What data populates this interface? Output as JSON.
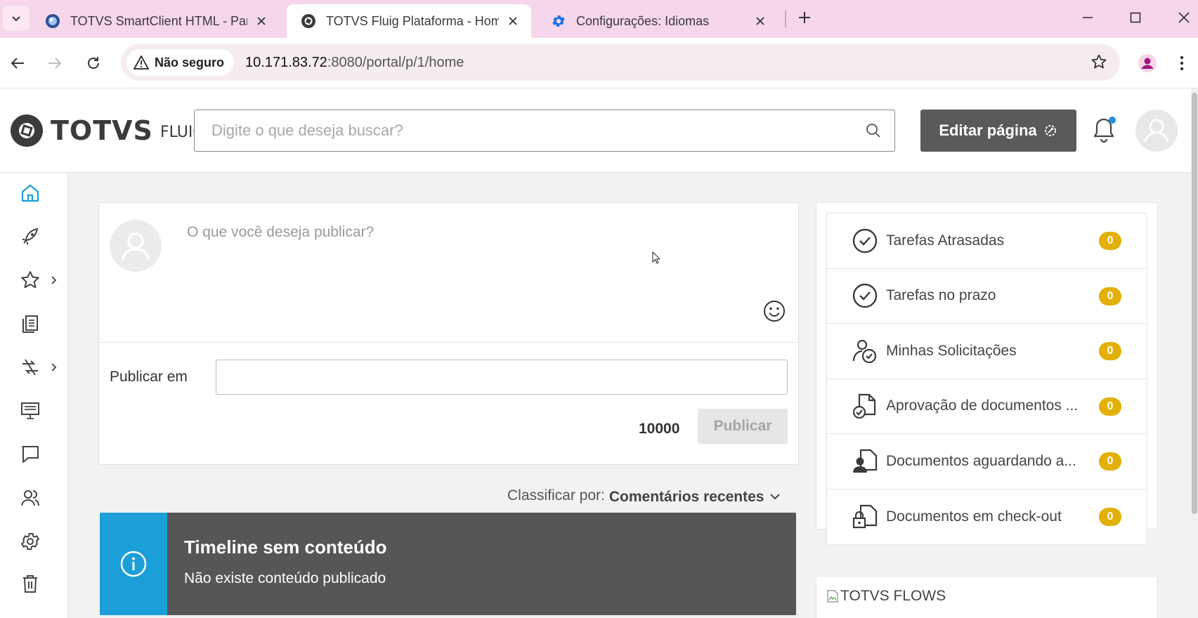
{
  "browser": {
    "tabs": [
      {
        "title": "TOTVS SmartClient HTML - Parâ",
        "favicon": "smartclient-icon",
        "active": false
      },
      {
        "title": "TOTVS Fluig Plataforma - Home",
        "favicon": "fluig-icon",
        "active": true
      },
      {
        "title": "Configurações: Idiomas",
        "favicon": "gear-icon",
        "active": false
      }
    ],
    "security_label": "Não seguro",
    "url_host": "10.171.83.72",
    "url_path": ":8080/portal/p/1/home",
    "colors": {
      "tabstrip": "#f5d6ea",
      "omnibox": "#f4ecf1"
    }
  },
  "header": {
    "brand": "TOTVS",
    "product": "FLUIG",
    "search_placeholder": "Digite o que deseja buscar?",
    "edit_label": "Editar página"
  },
  "sidebar": {
    "items": [
      {
        "icon": "home-icon",
        "active": true
      },
      {
        "icon": "rocket-icon"
      },
      {
        "icon": "star-icon",
        "expandable": true
      },
      {
        "icon": "documents-icon"
      },
      {
        "icon": "processes-icon",
        "expandable": true
      },
      {
        "icon": "presentation-icon"
      },
      {
        "icon": "chat-icon"
      },
      {
        "icon": "people-icon"
      },
      {
        "icon": "gear-icon"
      },
      {
        "icon": "trash-icon"
      }
    ]
  },
  "publish": {
    "placeholder": "O que você deseja publicar?",
    "publish_in_label": "Publicar em",
    "char_count": "10000",
    "button_label": "Publicar"
  },
  "sort": {
    "label": "Classificar por:",
    "value": "Comentários recentes"
  },
  "timeline": {
    "title": "Timeline sem conteúdo",
    "message": "Não existe conteúdo publicado",
    "colors": {
      "icon_bg": "#1c9fd8",
      "body_bg": "#555657"
    }
  },
  "tasks": [
    {
      "label": "Tarefas Atrasadas",
      "count": "0",
      "icon": "clock-check-icon"
    },
    {
      "label": "Tarefas no prazo",
      "count": "0",
      "icon": "clock-check-icon"
    },
    {
      "label": "Minhas Solicitações",
      "count": "0",
      "icon": "user-clock-icon"
    },
    {
      "label": "Aprovação de documentos ...",
      "count": "0",
      "icon": "doc-check-icon"
    },
    {
      "label": "Documentos aguardando a...",
      "count": "0",
      "icon": "doc-user-icon"
    },
    {
      "label": "Documentos em check-out",
      "count": "0",
      "icon": "doc-lock-icon"
    }
  ],
  "flows": {
    "alt_text": "TOTVS FLOWS"
  },
  "badge_color": "#e2b007"
}
